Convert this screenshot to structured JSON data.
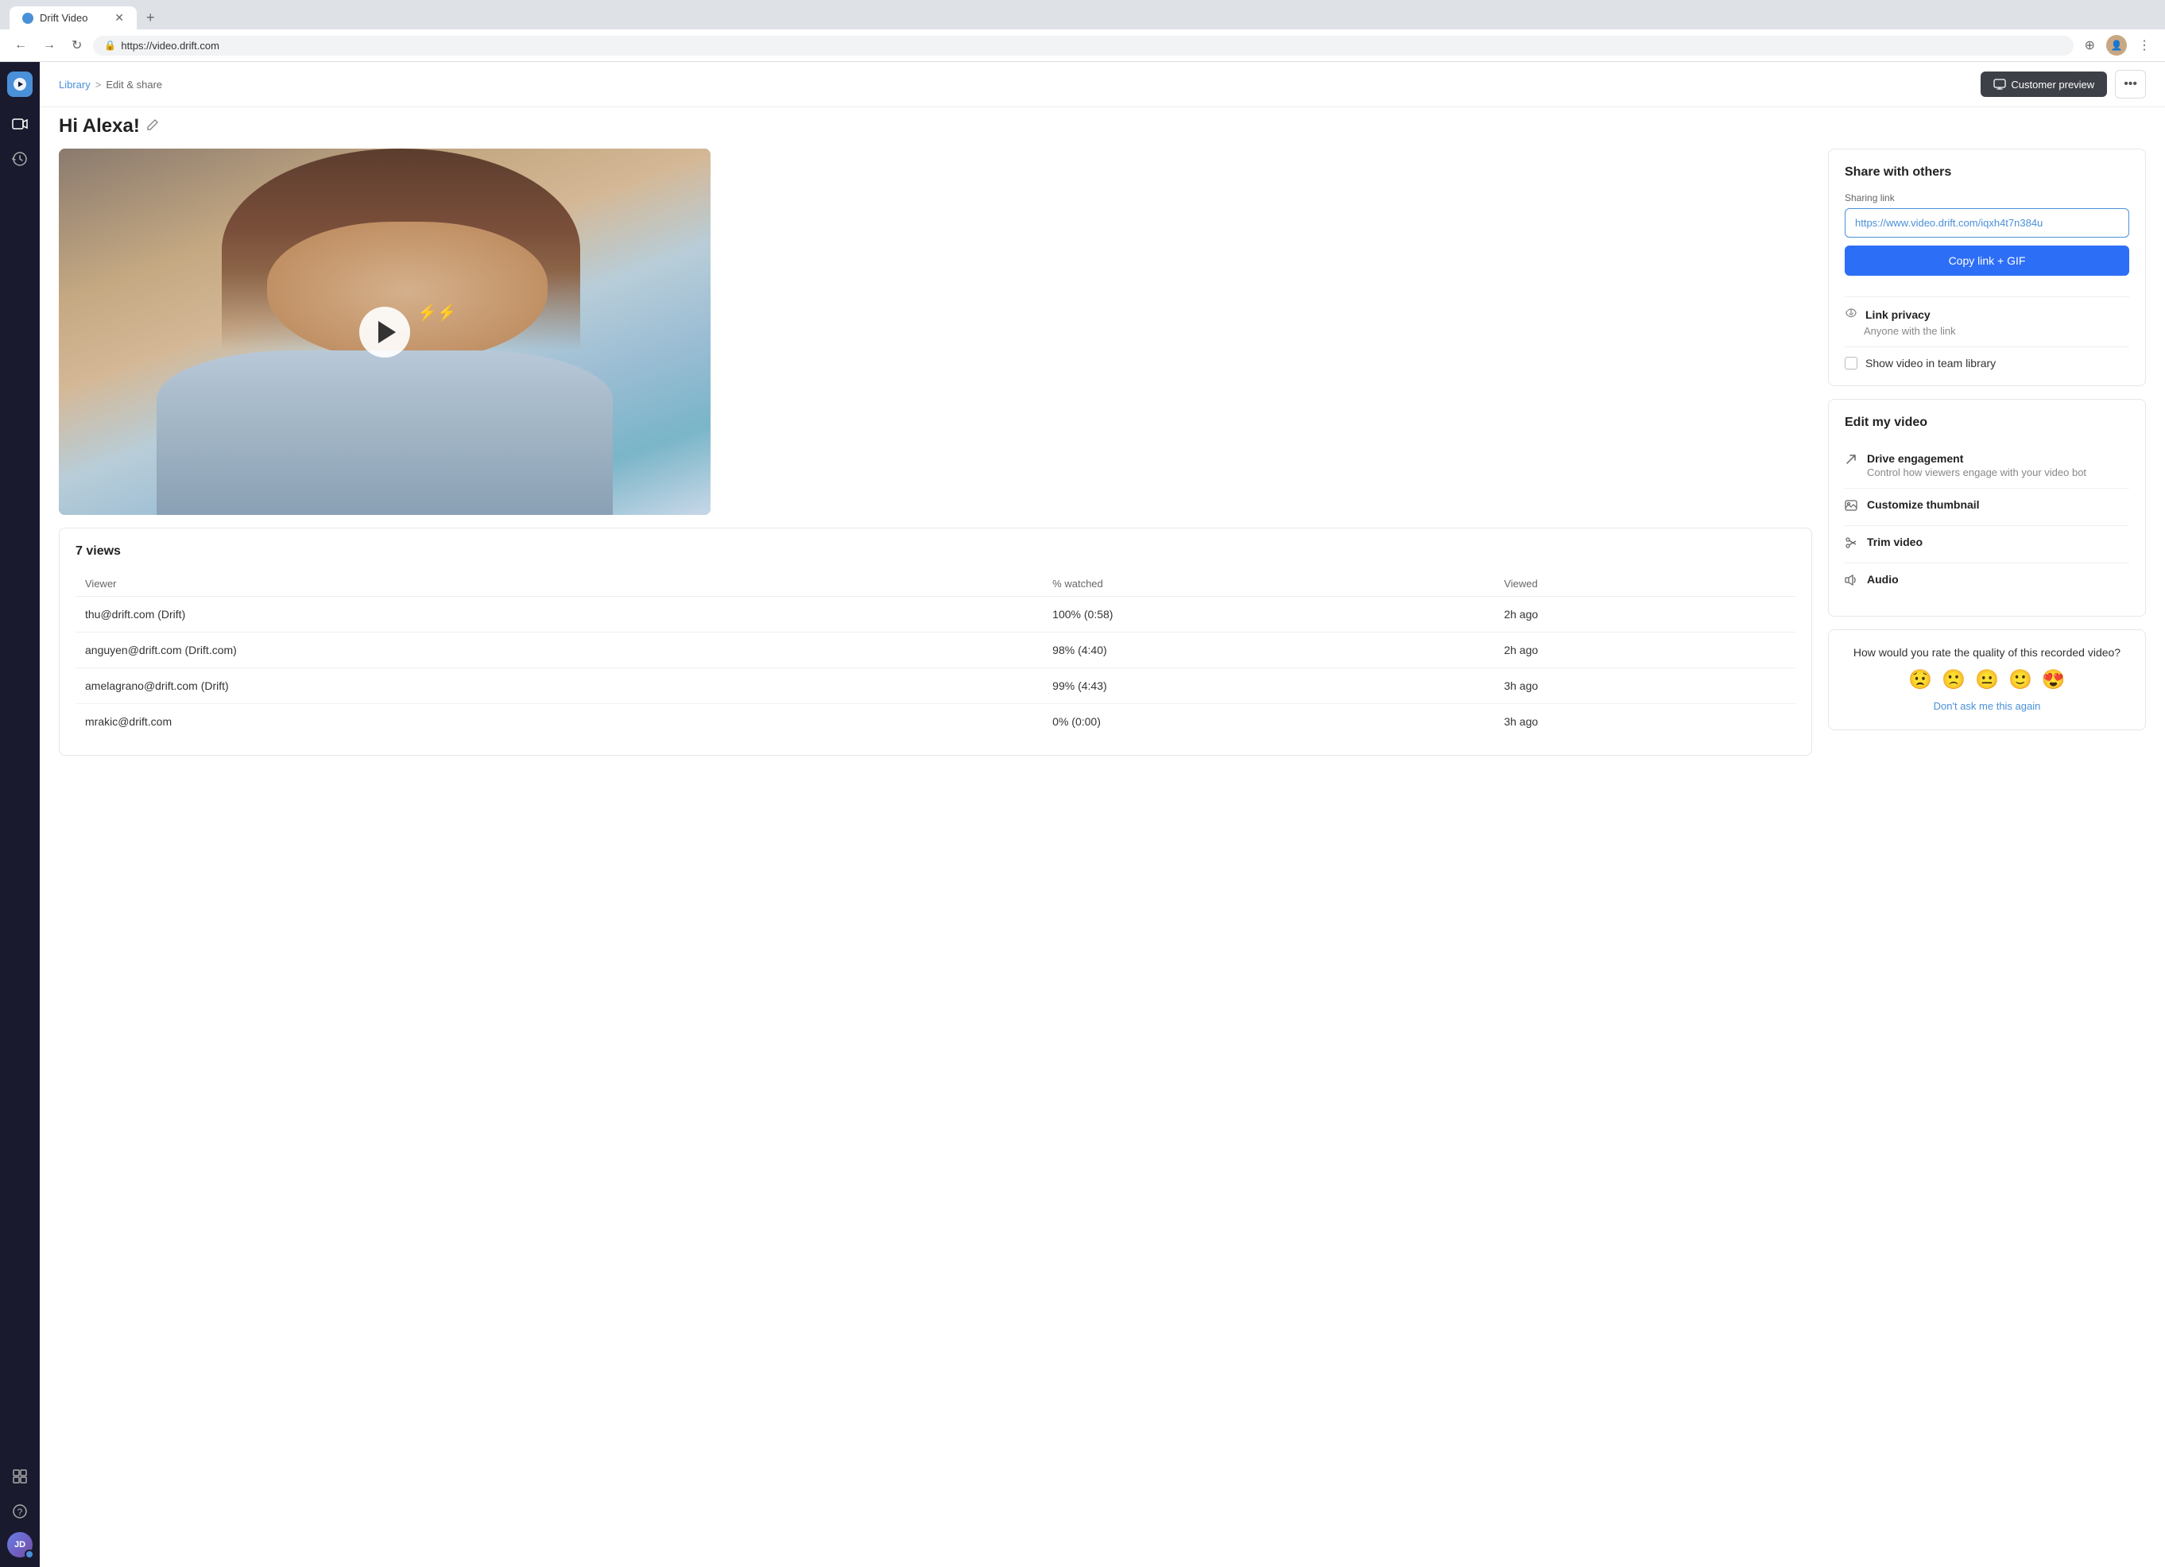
{
  "browser": {
    "tab_title": "Drift Video",
    "url": "https://video.drift.com",
    "new_tab_label": "+"
  },
  "breadcrumb": {
    "library": "Library",
    "separator": ">",
    "current": "Edit & share"
  },
  "page": {
    "title": "Hi Alexa!",
    "title_icon": "✏",
    "customer_preview_label": "Customer preview",
    "more_label": "•••"
  },
  "sharing": {
    "section_title": "Share with others",
    "link_label": "Sharing link",
    "link_value": "https://www.video.drift.com/iqxh4t7n384u",
    "copy_button_label": "Copy link + GIF",
    "link_privacy_title": "Link privacy",
    "link_privacy_sub": "Anyone with the link",
    "team_library_label": "Show video in team library"
  },
  "edit": {
    "section_title": "Edit my video",
    "items": [
      {
        "icon": "↗",
        "title": "Drive engagement",
        "subtitle": "Control how viewers engage with your video bot"
      },
      {
        "icon": "▣",
        "title": "Customize thumbnail",
        "subtitle": ""
      },
      {
        "icon": "✂",
        "title": "Trim video",
        "subtitle": ""
      },
      {
        "icon": "⚙",
        "title": "Audio",
        "subtitle": ""
      }
    ]
  },
  "rating": {
    "question": "How would you rate the quality of this recorded video?",
    "emojis": [
      "😟",
      "🙁",
      "😐",
      "🙂",
      "😍"
    ],
    "dismiss_label": "Don't ask me this again"
  },
  "views": {
    "count": "7 views",
    "columns": [
      "Viewer",
      "% watched",
      "Viewed"
    ],
    "rows": [
      {
        "viewer": "thu@drift.com (Drift)",
        "watched": "100% (0:58)",
        "viewed": "2h ago"
      },
      {
        "viewer": "anguyen@drift.com (Drift.com)",
        "watched": "98% (4:40)",
        "viewed": "2h ago"
      },
      {
        "viewer": "amelagrano@drift.com (Drift)",
        "watched": "99% (4:43)",
        "viewed": "3h ago"
      },
      {
        "viewer": "mrakic@drift.com",
        "watched": "0% (0:00)",
        "viewed": "3h ago"
      }
    ]
  },
  "sidebar": {
    "logo": "D",
    "items": [
      {
        "icon": "▶",
        "label": "Video",
        "active": true
      },
      {
        "icon": "⏱",
        "label": "History"
      },
      {
        "icon": "⊞",
        "label": "Apps"
      },
      {
        "icon": "?",
        "label": "Help"
      }
    ],
    "avatar_initials": "JD"
  },
  "colors": {
    "accent": "#2d6ef7",
    "link": "#4a90d9",
    "sidebar_bg": "#1a1a2e"
  }
}
